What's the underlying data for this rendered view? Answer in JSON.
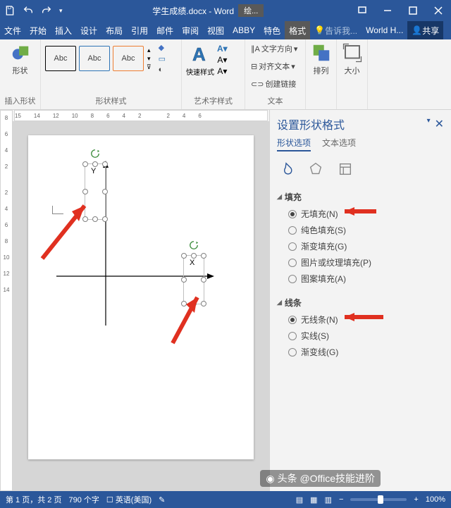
{
  "titlebar": {
    "doc_title": "学生成绩.docx - Word",
    "tools_context": "绘..."
  },
  "tabs": [
    "文件",
    "开始",
    "插入",
    "设计",
    "布局",
    "引用",
    "邮件",
    "审阅",
    "视图",
    "ABBY",
    "特色",
    "格式"
  ],
  "tell_me": "告诉我...",
  "world_h": "World H...",
  "share": "共享",
  "ribbon": {
    "shapes_label": "形状",
    "insert_shapes": "插入形状",
    "abc": "Abc",
    "shape_style_group": "形状样式",
    "shape_fill": "形状填充",
    "shape_outline": "形状轮廓",
    "shape_effects": "形状效果",
    "quick_style": "快速样式",
    "wordart_group": "艺术字样式",
    "text_dir": "文字方向",
    "align_text": "对齐文本",
    "create_link": "创建链接",
    "text_label": "文本",
    "arrange": "排列",
    "size": "大小"
  },
  "pane": {
    "title": "设置形状格式",
    "tab_shape": "形状选项",
    "tab_text": "文本选项",
    "fill_section": "填充",
    "fill_none": "无填充(N)",
    "fill_solid": "纯色填充(S)",
    "fill_gradient": "渐变填充(G)",
    "fill_picture": "图片或纹理填充(P)",
    "fill_pattern": "图案填充(A)",
    "line_section": "线条",
    "line_none": "无线条(N)",
    "line_solid": "实线(S)",
    "line_gradient": "渐变线(G)"
  },
  "canvas": {
    "y_label": "Y",
    "x_label": "X"
  },
  "hruler_ticks": [
    "15",
    "14",
    "12",
    "10",
    "8",
    "6",
    "4",
    "2",
    "",
    "2",
    "4",
    "6"
  ],
  "vruler_ticks": [
    "8",
    "6",
    "4",
    "2",
    "",
    "2",
    "4",
    "6",
    "8",
    "10",
    "12",
    "14"
  ],
  "status": {
    "page": "第 1 页，共 2 页",
    "words": "790 个字",
    "lang": "英语(美国)",
    "zoom": "100%"
  },
  "watermark": "头条 @Office技能进阶"
}
